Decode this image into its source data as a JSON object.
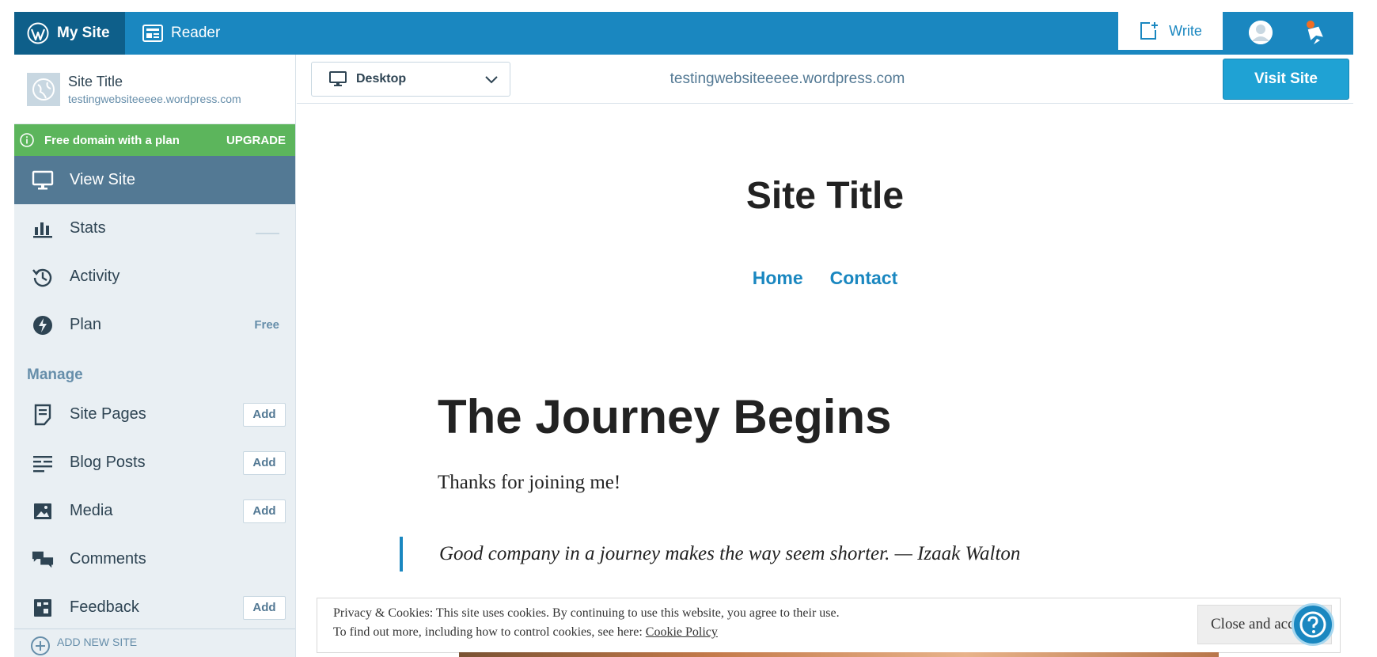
{
  "masterbar": {
    "my_site_label": "My Site",
    "reader_label": "Reader",
    "write_label": "Write",
    "icons": [
      "wordpress-logo-icon",
      "reader-icon",
      "write-icon",
      "avatar-icon",
      "notifications-icon"
    ]
  },
  "sidebar": {
    "site": {
      "title": "Site Title",
      "url": "testingwebsiteeeee.wordpress.com"
    },
    "upgrade": {
      "text": "Free domain with a plan",
      "button": "UPGRADE"
    },
    "items": [
      {
        "label": "View Site",
        "icon": "monitor-icon",
        "active": true
      },
      {
        "label": "Stats",
        "icon": "stats-icon"
      },
      {
        "label": "Activity",
        "icon": "history-icon"
      },
      {
        "label": "Plan",
        "icon": "plan-icon",
        "badge": "Free"
      }
    ],
    "manage_heading": "Manage",
    "manage_items": [
      {
        "label": "Site Pages",
        "icon": "pages-icon",
        "action": "Add"
      },
      {
        "label": "Blog Posts",
        "icon": "posts-icon",
        "action": "Add"
      },
      {
        "label": "Media",
        "icon": "media-icon",
        "action": "Add"
      },
      {
        "label": "Comments",
        "icon": "comments-icon"
      },
      {
        "label": "Feedback",
        "icon": "feedback-icon",
        "action": "Add"
      }
    ],
    "add_new_site": "ADD NEW SITE"
  },
  "preview_toolbar": {
    "device": "Desktop",
    "url": "testingwebsiteeeee.wordpress.com",
    "visit_button": "Visit Site"
  },
  "preview": {
    "site_title": "Site Title",
    "menu": [
      "Home",
      "Contact"
    ],
    "post_title": "The Journey Begins",
    "paragraph": "Thanks for joining me!",
    "quote": "Good company in a journey makes the way seem shorter. — Izaak Walton"
  },
  "cookie_banner": {
    "line1": "Privacy & Cookies: This site uses cookies. By continuing to use this website, you agree to their use.",
    "line2_prefix": "To find out more, including how to control cookies, see here: ",
    "link": "Cookie Policy",
    "close_button": "Close and accept"
  },
  "colors": {
    "masterbar": "#1a87c0",
    "masterbar_active": "#0e5f8a",
    "upgrade_green": "#5cb55c",
    "sidebar_active": "#537994",
    "visit_button": "#1fa2d4"
  }
}
